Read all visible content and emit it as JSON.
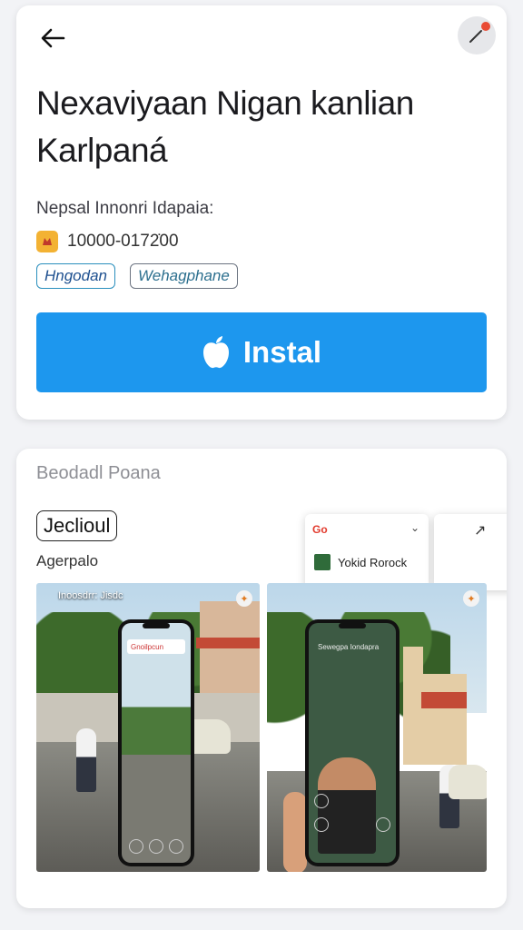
{
  "header": {
    "back_icon": "arrow-left-icon",
    "action_icon": "wand-icon",
    "accent_dot_color": "#e94b35"
  },
  "app": {
    "title": "Nexaviyaan Nigan kanlian Karlpaná",
    "subtitle": "Nepsal Innonri Idapaia:",
    "meta_value": "10000-0172̇00",
    "tags": [
      "Hngodan",
      "Wehagphane"
    ]
  },
  "install": {
    "label": "Instal",
    "icon": "apple-icon",
    "color": "#1d97ee"
  },
  "gallery": {
    "section_title": "Beodadl Poana",
    "chip_label": "Jeclioul",
    "chip_sub": "Agerpalo",
    "popover_tag": "Go",
    "popover_item": "Yokid Rorock",
    "shots": [
      {
        "label": "Inoosdrr: Jisdc",
        "screen_bar": "Gnoilpcun"
      },
      {
        "label": "",
        "screen_bar": "Sewegpa Iondapra"
      }
    ]
  }
}
